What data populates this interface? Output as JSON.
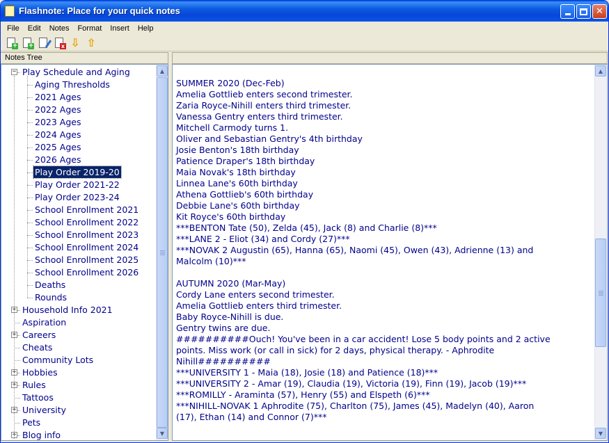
{
  "window": {
    "title": "Flashnote: Place for your quick notes"
  },
  "menu": [
    "File",
    "Edit",
    "Notes",
    "Format",
    "Insert",
    "Help"
  ],
  "toolbar": {
    "icons": [
      "new-note-icon",
      "new-subnote-icon",
      "edit-note-icon",
      "delete-note-icon",
      "move-down-icon",
      "move-up-icon"
    ]
  },
  "tree": {
    "header": "Notes Tree",
    "items": [
      {
        "label": "Play Schedule and Aging",
        "level": 0,
        "expander": "−"
      },
      {
        "label": "Aging Thresholds",
        "level": 1
      },
      {
        "label": "2021 Ages",
        "level": 1
      },
      {
        "label": "2022 Ages",
        "level": 1
      },
      {
        "label": "2023 Ages",
        "level": 1
      },
      {
        "label": "2024 Ages",
        "level": 1
      },
      {
        "label": "2025 Ages",
        "level": 1
      },
      {
        "label": "2026 Ages",
        "level": 1
      },
      {
        "label": "Play Order 2019-20",
        "level": 1,
        "selected": true
      },
      {
        "label": "Play Order 2021-22",
        "level": 1
      },
      {
        "label": "Play Order 2023-24",
        "level": 1
      },
      {
        "label": "School Enrollment 2021",
        "level": 1
      },
      {
        "label": "School Enrollment 2022",
        "level": 1
      },
      {
        "label": "School Enrollment 2023",
        "level": 1
      },
      {
        "label": "School Enrollment 2024",
        "level": 1
      },
      {
        "label": "School Enrollment 2025",
        "level": 1
      },
      {
        "label": "School Enrollment 2026",
        "level": 1
      },
      {
        "label": "Deaths",
        "level": 1
      },
      {
        "label": "Rounds",
        "level": 1
      },
      {
        "label": "Household Info 2021",
        "level": 0,
        "expander": "+"
      },
      {
        "label": "Aspiration",
        "level": 0
      },
      {
        "label": "Careers",
        "level": 0,
        "expander": "+"
      },
      {
        "label": "Cheats",
        "level": 0
      },
      {
        "label": "Community Lots",
        "level": 0
      },
      {
        "label": "Hobbies",
        "level": 0,
        "expander": "+"
      },
      {
        "label": "Rules",
        "level": 0,
        "expander": "+"
      },
      {
        "label": "Tattoos",
        "level": 0
      },
      {
        "label": "University",
        "level": 0,
        "expander": "+"
      },
      {
        "label": "Pets",
        "level": 0
      },
      {
        "label": "Blog info",
        "level": 0,
        "expander": "+"
      }
    ]
  },
  "note": {
    "lines": [
      "SUMMER 2020 (Dec-Feb)",
      "Amelia Gottlieb enters second trimester.",
      "Zaria Royce-Nihill enters third trimester.",
      "Vanessa Gentry enters third trimester.",
      "Mitchell Carmody turns 1.",
      "Oliver and Sebastian Gentry's 4th birthday",
      "Josie Benton's 18th birthday",
      "Patience Draper's 18th birthday",
      "Maia Novak's 18th birthday",
      "Linnea Lane's 60th birthday",
      "Athena Gottlieb's 60th birthday",
      "Debbie Lane's 60th birthday",
      "Kit Royce's 60th birthday",
      "***BENTON Tate (50), Zelda (45), Jack (8) and Charlie (8)***",
      "***LANE 2 - Eliot (34) and Cordy (27)***",
      "***NOVAK 2 Augustin (65), Hanna (65), Naomi (45), Owen (43), Adrienne (13) and",
      "Malcolm (10)***",
      "",
      "AUTUMN 2020 (Mar-May)",
      "Cordy Lane enters second trimester.",
      "Amelia Gottlieb enters third trimester.",
      "Baby Royce-Nihill is due.",
      "Gentry twins are due.",
      "##########Ouch! You've been in a car accident! Lose 5 body points and 2 active",
      "points. Miss work (or call in sick) for 2 days, physical therapy. - Aphrodite",
      "Nihill##########",
      "***UNIVERSITY 1 - Maia (18), Josie (18) and Patience (18)***",
      "***UNIVERSITY 2 - Amar (19), Claudia (19), Victoria (19), Finn (19), Jacob (19)***",
      "***ROMILLY - Araminta (57), Henry (55) and Elspeth (6)***",
      "***NIHILL-NOVAK 1 Aphrodite (75), Charlton (75), James (45), Madelyn (40), Aaron",
      "(17), Ethan (14) and Connor (7)***"
    ]
  },
  "colors": {
    "titlebar": "#0846d8",
    "text": "#00008b",
    "selection": "#0a246a"
  }
}
